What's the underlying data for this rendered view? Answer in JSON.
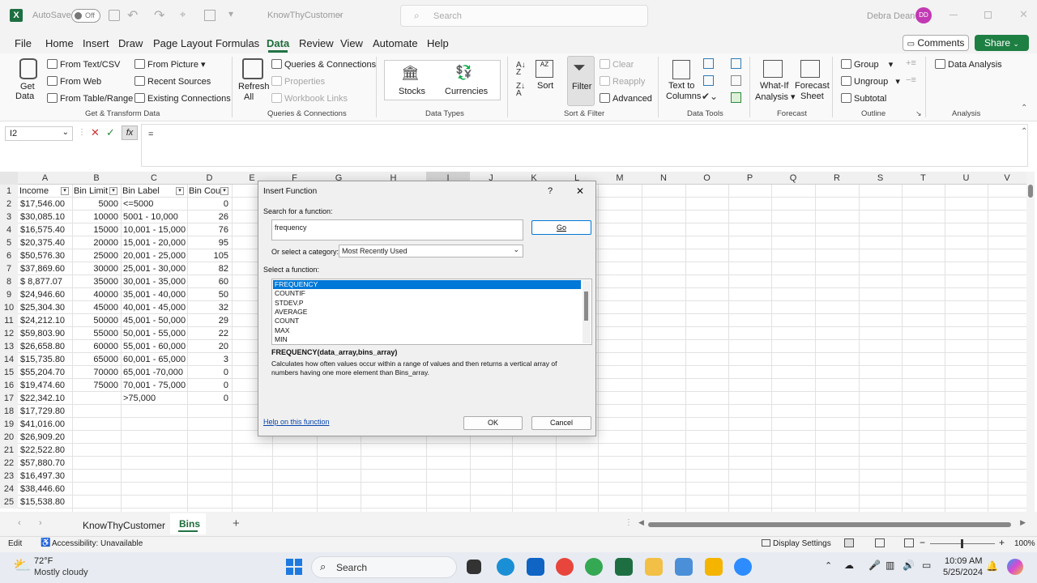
{
  "titlebar": {
    "autosave": "AutoSave",
    "autosave_state": "Off",
    "filename": "KnowThyCustomer",
    "search": "Search",
    "user": "Debra Dean",
    "initials": "DD"
  },
  "tabs": [
    "File",
    "Home",
    "Insert",
    "Draw",
    "Page Layout",
    "Formulas",
    "Data",
    "Review",
    "View",
    "Automate",
    "Help"
  ],
  "comments": "Comments",
  "share": "Share",
  "ribbon": {
    "get_data": "Get",
    "get_data2": "Data",
    "from_text": "From Text/CSV",
    "from_web": "From Web",
    "from_table": "From Table/Range",
    "from_picture": "From Picture",
    "recent_sources": "Recent Sources",
    "existing_connections": "Existing Connections",
    "refresh": "Refresh",
    "refresh2": "All",
    "queries": "Queries & Connections",
    "properties": "Properties",
    "workbook_links": "Workbook Links",
    "stocks": "Stocks",
    "currencies": "Currencies",
    "sort": "Sort",
    "filter": "Filter",
    "clear": "Clear",
    "reapply": "Reapply",
    "advanced": "Advanced",
    "text_to_columns": "Text to",
    "text_to_columns2": "Columns",
    "what_if": "What-If",
    "what_if2": "Analysis",
    "forecast": "Forecast",
    "forecast2": "Sheet",
    "group": "Group",
    "ungroup": "Ungroup",
    "subtotal": "Subtotal",
    "data_analysis": "Data Analysis",
    "groups": [
      "Get & Transform Data",
      "Queries & Connections",
      "Data Types",
      "Sort & Filter",
      "Data Tools",
      "Forecast",
      "Outline",
      "Analysis"
    ]
  },
  "formula": {
    "namebox": "I2",
    "content": "="
  },
  "columns": [
    "A",
    "B",
    "C",
    "D",
    "E",
    "F",
    "G",
    "H",
    "I",
    "J",
    "K",
    "L",
    "M",
    "N",
    "O",
    "P",
    "Q",
    "R",
    "S",
    "T",
    "U",
    "V"
  ],
  "headers": {
    "a": "Income",
    "b": "Bin Limit",
    "c": "Bin Label",
    "d": "Bin Cou"
  },
  "rows": [
    {
      "n": "1"
    },
    {
      "n": "2",
      "a": "$17,546.00",
      "b": "5000",
      "c": "<=5000",
      "d": "0"
    },
    {
      "n": "3",
      "a": "$30,085.10",
      "b": "10000",
      "c": "5001 - 10,000",
      "d": "26"
    },
    {
      "n": "4",
      "a": "$16,575.40",
      "b": "15000",
      "c": "10,001 - 15,000",
      "d": "76"
    },
    {
      "n": "5",
      "a": "$20,375.40",
      "b": "20000",
      "c": "15,001 - 20,000",
      "d": "95"
    },
    {
      "n": "6",
      "a": "$50,576.30",
      "b": "25000",
      "c": "20,001 - 25,000",
      "d": "105"
    },
    {
      "n": "7",
      "a": "$37,869.60",
      "b": "30000",
      "c": "25,001 - 30,000",
      "d": "82"
    },
    {
      "n": "8",
      "a": "$  8,877.07",
      "b": "35000",
      "c": "30,001 - 35,000",
      "d": "60"
    },
    {
      "n": "9",
      "a": "$24,946.60",
      "b": "40000",
      "c": "35,001 - 40,000",
      "d": "50"
    },
    {
      "n": "10",
      "a": "$25,304.30",
      "b": "45000",
      "c": "40,001 - 45,000",
      "d": "32"
    },
    {
      "n": "11",
      "a": "$24,212.10",
      "b": "50000",
      "c": "45,001 - 50,000",
      "d": "29"
    },
    {
      "n": "12",
      "a": "$59,803.90",
      "b": "55000",
      "c": "50,001 - 55,000",
      "d": "22"
    },
    {
      "n": "13",
      "a": "$26,658.80",
      "b": "60000",
      "c": "55,001 - 60,000",
      "d": "20"
    },
    {
      "n": "14",
      "a": "$15,735.80",
      "b": "65000",
      "c": "60,001 - 65,000",
      "d": "3"
    },
    {
      "n": "15",
      "a": "$55,204.70",
      "b": "70000",
      "c": "65,001 -70,000",
      "d": "0"
    },
    {
      "n": "16",
      "a": "$19,474.60",
      "b": "75000",
      "c": "70,001 - 75,000",
      "d": "0"
    },
    {
      "n": "17",
      "a": "$22,342.10",
      "b": "",
      "c": ">75,000",
      "d": "0"
    },
    {
      "n": "18",
      "a": "$17,729.80"
    },
    {
      "n": "19",
      "a": "$41,016.00"
    },
    {
      "n": "20",
      "a": "$26,909.20"
    },
    {
      "n": "21",
      "a": "$22,522.80"
    },
    {
      "n": "22",
      "a": "$57,880.70"
    },
    {
      "n": "23",
      "a": "$16,497.30"
    },
    {
      "n": "24",
      "a": "$38,446.60"
    },
    {
      "n": "25",
      "a": "$15,538.80"
    }
  ],
  "dialog": {
    "title": "Insert Function",
    "help_q": "?",
    "close": "✕",
    "search_label": "Search for a function:",
    "search_value": "frequency",
    "go": "Go",
    "category_label": "Or select a category:",
    "category_value": "Most Recently Used",
    "select_label": "Select a function:",
    "functions": [
      "FREQUENCY",
      "COUNTIF",
      "STDEV.P",
      "AVERAGE",
      "COUNT",
      "MAX",
      "MIN"
    ],
    "signature": "FREQUENCY(data_array,bins_array)",
    "description": "Calculates how often values occur within a range of values and then returns a vertical array of numbers having one more element than Bins_array.",
    "help_link": "Help on this function",
    "ok": "OK",
    "cancel": "Cancel"
  },
  "sheets": [
    "KnowThyCustomer",
    "Bins"
  ],
  "status": {
    "mode": "Edit",
    "accessibility": "Accessibility: Unavailable",
    "display": "Display Settings",
    "zoom": "100%"
  },
  "taskbar": {
    "temp": "72°F",
    "weather": "Mostly cloudy",
    "search": "Search",
    "time": "10:09 AM",
    "date": "5/25/2024"
  },
  "colors": {
    "accent": "#217346",
    "selection": "#0078d7",
    "share": "#1e7f43"
  }
}
